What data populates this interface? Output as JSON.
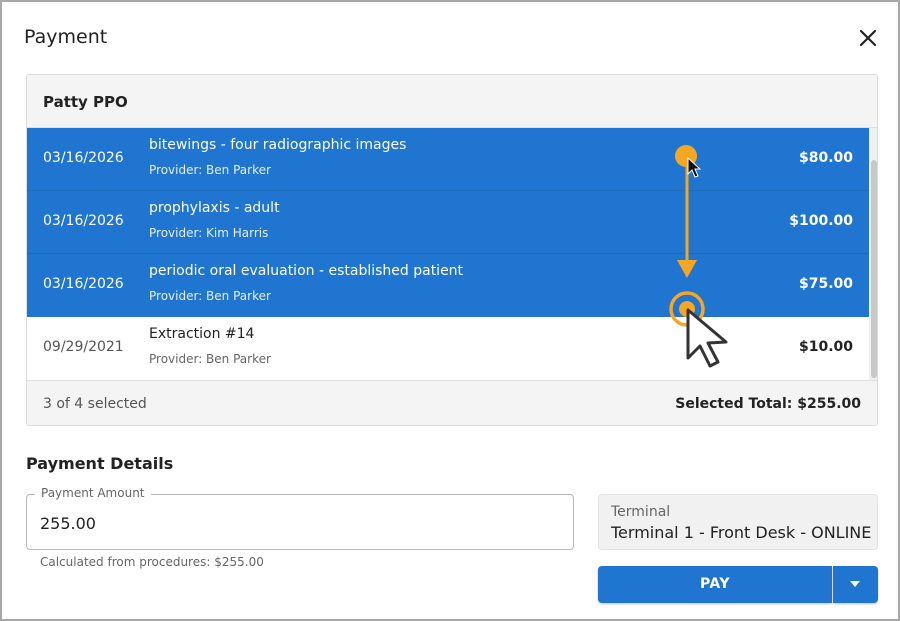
{
  "dialog": {
    "title": "Payment",
    "close_icon": "close-icon"
  },
  "plan": {
    "name": "Patty PPO"
  },
  "procedures": [
    {
      "date": "03/16/2026",
      "description": "bitewings - four radiographic images",
      "provider": "Provider: Ben Parker",
      "amount": "$80.00",
      "selected": true
    },
    {
      "date": "03/16/2026",
      "description": "prophylaxis - adult",
      "provider": "Provider: Kim Harris",
      "amount": "$100.00",
      "selected": true
    },
    {
      "date": "03/16/2026",
      "description": "periodic oral evaluation - established patient",
      "provider": "Provider: Ben Parker",
      "amount": "$75.00",
      "selected": true
    },
    {
      "date": "09/29/2021",
      "description": "Extraction #14",
      "provider": "Provider: Ben Parker",
      "amount": "$10.00",
      "selected": false
    }
  ],
  "summary": {
    "selected_count": "3 of 4 selected",
    "selected_total": "Selected Total: $255.00"
  },
  "payment_details": {
    "title": "Payment Details",
    "amount_label": "Payment Amount",
    "amount_value": "255.00",
    "helper": "Calculated from procedures: $255.00"
  },
  "terminal": {
    "label": "Terminal",
    "value": "Terminal 1 - Front Desk - ONLINE"
  },
  "actions": {
    "pay_label": "PAY",
    "menu_icon": "caret-down-icon"
  },
  "colors": {
    "accent": "#1f75d0",
    "drag_indicator": "#f5a623"
  }
}
